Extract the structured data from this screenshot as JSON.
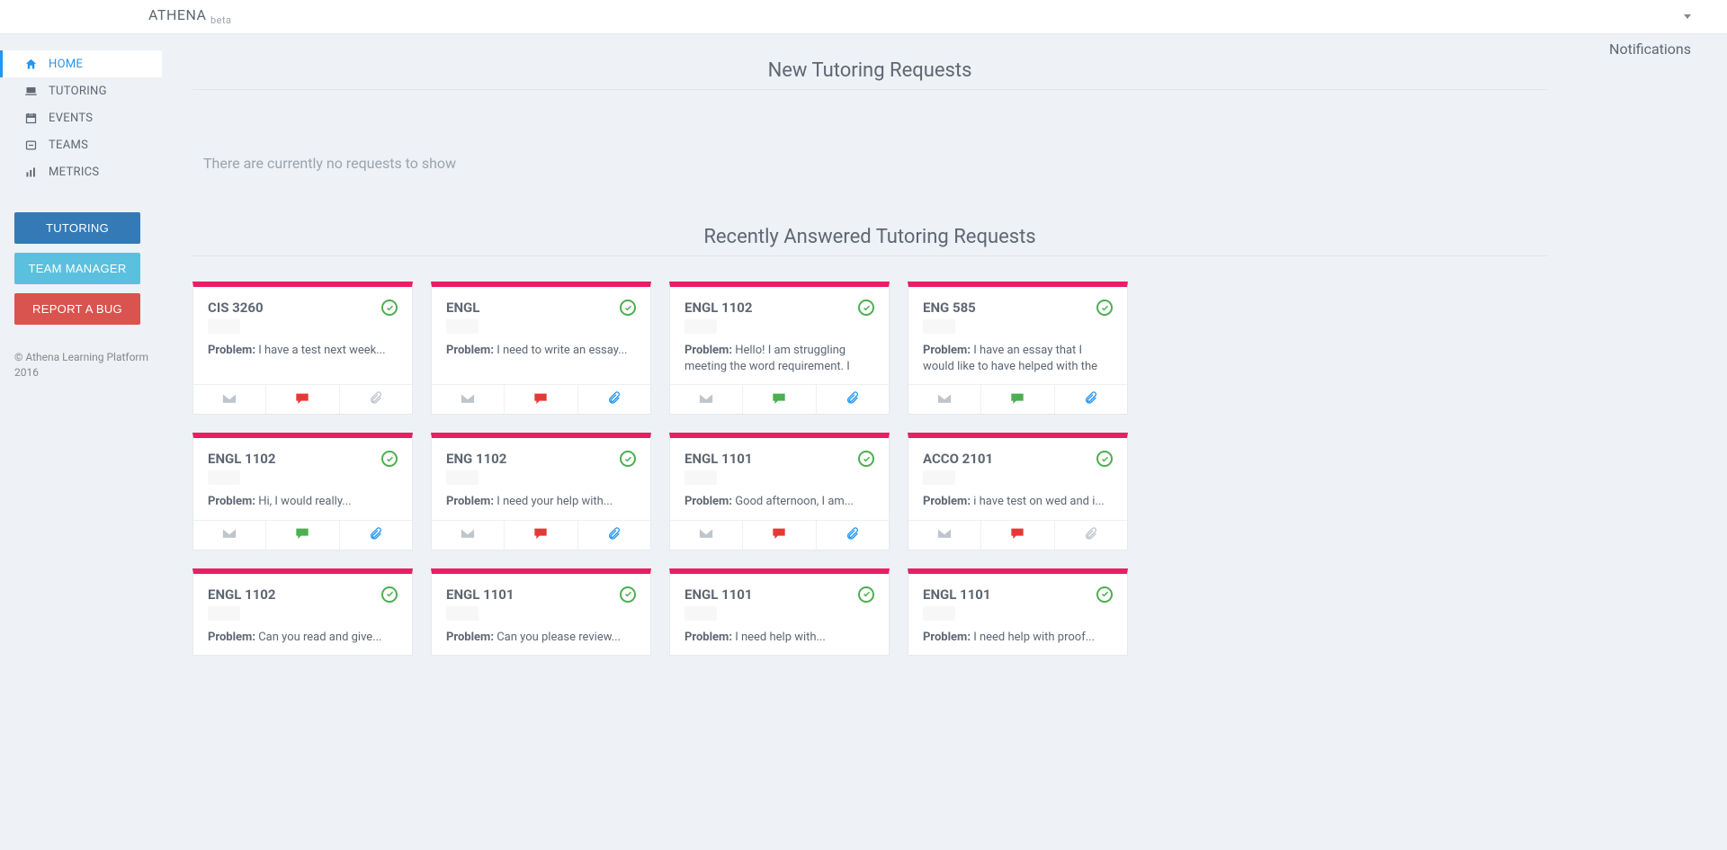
{
  "brand": {
    "name": "ATHENA",
    "tag": "beta"
  },
  "topRightLabel": "",
  "notifications": "Notifications",
  "nav": {
    "items": [
      {
        "label": "HOME"
      },
      {
        "label": "TUTORING"
      },
      {
        "label": "EVENTS"
      },
      {
        "label": "TEAMS"
      },
      {
        "label": "METRICS"
      }
    ]
  },
  "sidebarButtons": {
    "tutoring": "TUTORING",
    "teamManager": "TEAM MANAGER",
    "reportBug": "REPORT A BUG"
  },
  "footer": {
    "line1": "© Athena Learning Platform",
    "line2": "2016"
  },
  "sections": {
    "newRequests": {
      "title": "New Tutoring Requests",
      "emptyMessage": "There are currently no requests to show"
    },
    "recent": {
      "title": "Recently Answered Tutoring Requests"
    }
  },
  "problemLabel": "Problem:",
  "cards": [
    {
      "course": "CIS 3260",
      "problem": "I have a test next week...",
      "chat": "red",
      "clip": "grey"
    },
    {
      "course": "ENGL",
      "problem": "I need to write an essay...",
      "chat": "red",
      "clip": "blue"
    },
    {
      "course": "ENGL 1102",
      "problem": "Hello! I am struggling meeting the word requirement. I",
      "chat": "green",
      "clip": "blue"
    },
    {
      "course": "ENG 585",
      "problem": "I have an essay that I would like to have helped with the",
      "chat": "green",
      "clip": "blue"
    },
    {
      "course": "ENGL 1102",
      "problem": "Hi, I would really...",
      "chat": "green",
      "clip": "blue"
    },
    {
      "course": "ENG 1102",
      "problem": "I need your help with...",
      "chat": "red",
      "clip": "blue"
    },
    {
      "course": "ENGL 1101",
      "problem": "Good afternoon, I am...",
      "chat": "red",
      "clip": "blue"
    },
    {
      "course": "ACCO 2101",
      "problem": "i have test on wed and i...",
      "chat": "red",
      "clip": "grey"
    },
    {
      "course": "ENGL 1102",
      "problem": "Can you read and give...",
      "chat": "",
      "clip": ""
    },
    {
      "course": "ENGL 1101",
      "problem": "Can you please review...",
      "chat": "",
      "clip": ""
    },
    {
      "course": "ENGL 1101",
      "problem": "I need help with...",
      "chat": "",
      "clip": ""
    },
    {
      "course": "ENGL 1101",
      "problem": "I need help with proof...",
      "chat": "",
      "clip": ""
    }
  ]
}
